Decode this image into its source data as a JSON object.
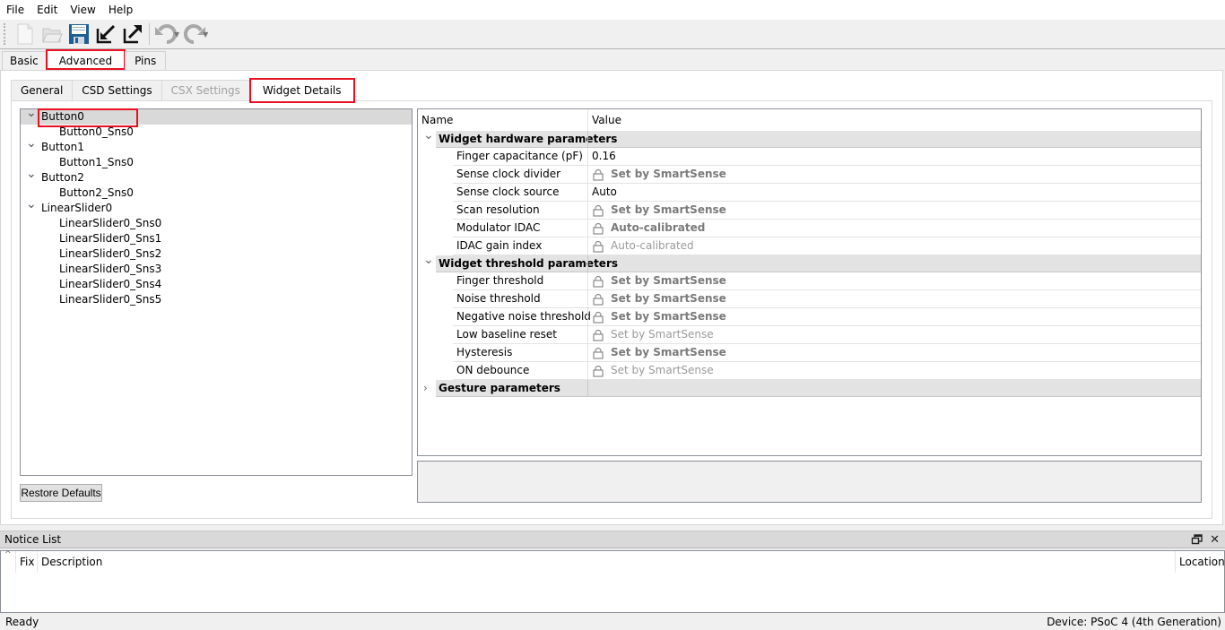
{
  "menu": [
    "File",
    "Edit",
    "View",
    "Help"
  ],
  "toolbar": {
    "buttons": [
      {
        "name": "new-file-icon"
      },
      {
        "name": "open-folder-icon"
      },
      {
        "name": "save-icon"
      },
      {
        "name": "import-icon"
      },
      {
        "name": "export-icon"
      },
      {
        "name": "undo-icon"
      },
      {
        "name": "redo-icon"
      }
    ]
  },
  "main_tabs": {
    "basic": "Basic",
    "advanced": "Advanced",
    "pins": "Pins",
    "active": "Advanced"
  },
  "sub_tabs": {
    "general": "General",
    "csd": "CSD Settings",
    "csx": "CSX Settings",
    "widget_details": "Widget Details",
    "active": "Widget Details"
  },
  "tree": {
    "items": [
      {
        "label": "Button0",
        "level": 0,
        "expanded": true,
        "selected": true
      },
      {
        "label": "Button0_Sns0",
        "level": 1
      },
      {
        "label": "Button1",
        "level": 0,
        "expanded": true
      },
      {
        "label": "Button1_Sns0",
        "level": 1
      },
      {
        "label": "Button2",
        "level": 0,
        "expanded": true
      },
      {
        "label": "Button2_Sns0",
        "level": 1
      },
      {
        "label": "LinearSlider0",
        "level": 0,
        "expanded": true
      },
      {
        "label": "LinearSlider0_Sns0",
        "level": 1
      },
      {
        "label": "LinearSlider0_Sns1",
        "level": 1
      },
      {
        "label": "LinearSlider0_Sns2",
        "level": 1
      },
      {
        "label": "LinearSlider0_Sns3",
        "level": 1
      },
      {
        "label": "LinearSlider0_Sns4",
        "level": 1
      },
      {
        "label": "LinearSlider0_Sns5",
        "level": 1
      }
    ]
  },
  "restore_defaults": "Restore Defaults",
  "grid": {
    "header_name": "Name",
    "header_value": "Value",
    "categories": [
      {
        "label": "Widget hardware parameters",
        "expanded": true,
        "props": [
          {
            "name": "Finger capacitance (pF)",
            "value": "0.16",
            "locked": false
          },
          {
            "name": "Sense clock divider",
            "value": "Set by SmartSense",
            "locked": true,
            "style": "bold"
          },
          {
            "name": "Sense clock source",
            "value": "Auto",
            "locked": false
          },
          {
            "name": "Scan resolution",
            "value": "Set by SmartSense",
            "locked": true,
            "style": "bold"
          },
          {
            "name": "Modulator IDAC",
            "value": "Auto-calibrated",
            "locked": true,
            "style": "bold"
          },
          {
            "name": "IDAC gain index",
            "value": "Auto-calibrated",
            "locked": true,
            "style": "light"
          }
        ]
      },
      {
        "label": "Widget threshold parameters",
        "expanded": true,
        "props": [
          {
            "name": "Finger threshold",
            "value": "Set by SmartSense",
            "locked": true,
            "style": "bold"
          },
          {
            "name": "Noise threshold",
            "value": "Set by SmartSense",
            "locked": true,
            "style": "bold"
          },
          {
            "name": "Negative noise threshold",
            "value": "Set by SmartSense",
            "locked": true,
            "style": "bold"
          },
          {
            "name": "Low baseline reset",
            "value": "Set by SmartSense",
            "locked": true,
            "style": "light"
          },
          {
            "name": "Hysteresis",
            "value": "Set by SmartSense",
            "locked": true,
            "style": "bold"
          },
          {
            "name": "ON debounce",
            "value": "Set by SmartSense",
            "locked": true,
            "style": "light"
          }
        ]
      },
      {
        "label": "Gesture parameters",
        "expanded": false,
        "props": []
      }
    ]
  },
  "notice_list": {
    "title": "Notice List",
    "columns": {
      "fix": "Fix",
      "description": "Description",
      "location": "Location"
    }
  },
  "status": {
    "left": "Ready",
    "right": "Device: PSoC 4 (4th Generation)"
  },
  "colors": {
    "highlight_red": "#e81123",
    "selection_gray": "#d9d9d9",
    "category_gray": "#e3e3e3"
  }
}
